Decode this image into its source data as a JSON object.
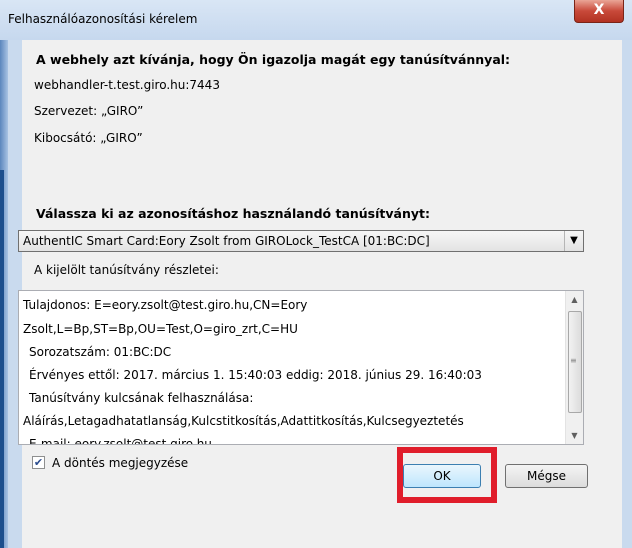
{
  "window": {
    "title": "Felhasználóazonosítási kérelem",
    "close_label": "X"
  },
  "request": {
    "heading": "A webhely azt kívánja, hogy Ön igazolja magát egy tanúsítvánnyal:",
    "host": "webhandler-t.test.giro.hu:7443",
    "organization": "Szervezet: „GIRO”",
    "issuer": "Kibocsátó: „GIRO”"
  },
  "certificate": {
    "heading": "Válassza ki az azonosításhoz használandó tanúsítványt:",
    "selected": "AuthentIC Smart Card:Eory Zsolt from GIROLock_TestCA [01:BC:DC]",
    "details_label": "A kijelölt tanúsítvány részletei:",
    "details_lines": [
      "Tulajdonos: E=eory.zsolt@test.giro.hu,CN=Eory",
      "Zsolt,L=Bp,ST=Bp,OU=Test,O=giro_zrt,C=HU",
      "  Sorozatszám: 01:BC:DC",
      "  Érvényes ettől: 2017. március 1. 15:40:03 eddig: 2018. június 29. 16:40:03",
      "  Tanúsítvány kulcsának felhasználása:",
      "Aláírás,Letagadhatatlanság,Kulcstitkosítás,Adattitkosítás,Kulcsegyeztetés",
      "  E-mail: eory.zsolt@test.giro.hu"
    ]
  },
  "remember": {
    "label": "A döntés megjegyzése",
    "checked": true
  },
  "buttons": {
    "ok": "OK",
    "cancel": "Mégse"
  },
  "colors": {
    "highlight": "#e01d2b",
    "window_frame": "#c9daee",
    "close_button": "#c8493a"
  }
}
